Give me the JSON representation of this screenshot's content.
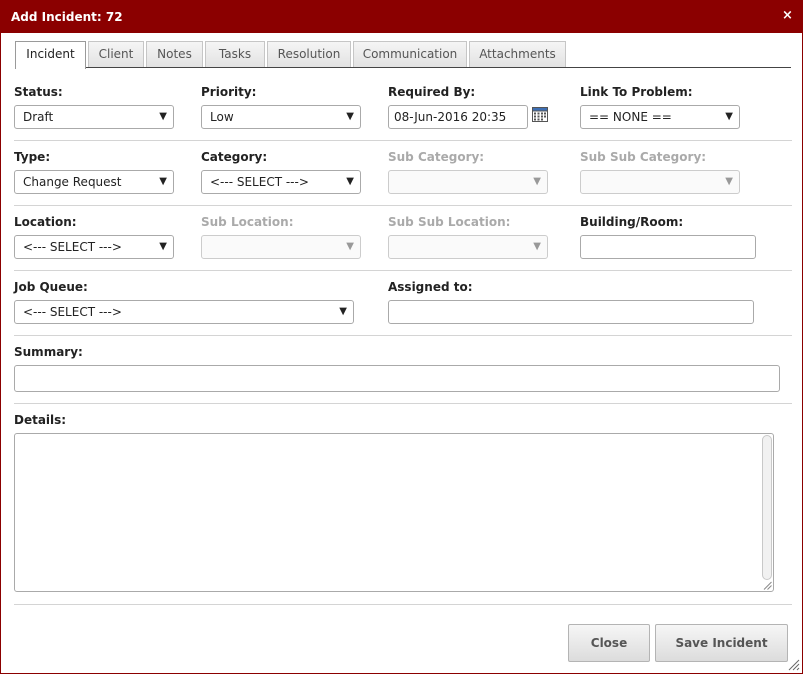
{
  "dialog": {
    "title": "Add Incident: 72",
    "close_glyph": "×",
    "colors": {
      "titlebar": "#8b0000"
    }
  },
  "tabs": [
    {
      "label": "Incident",
      "active": true
    },
    {
      "label": "Client"
    },
    {
      "label": "Notes"
    },
    {
      "label": "Tasks"
    },
    {
      "label": "Resolution"
    },
    {
      "label": "Communication"
    },
    {
      "label": "Attachments"
    }
  ],
  "form": {
    "status": {
      "label": "Status:",
      "value": "Draft"
    },
    "priority": {
      "label": "Priority:",
      "value": "Low"
    },
    "required_by": {
      "label": "Required By:",
      "value": "08-Jun-2016 20:35",
      "icon": "calendar-icon"
    },
    "link_to_problem": {
      "label": "Link To Problem:",
      "value": "== NONE =="
    },
    "type": {
      "label": "Type:",
      "value": "Change Request"
    },
    "category": {
      "label": "Category:",
      "value": "<--- SELECT --->"
    },
    "sub_category": {
      "label": "Sub Category:",
      "value": ""
    },
    "sub_sub_category": {
      "label": "Sub Sub Category:",
      "value": ""
    },
    "location": {
      "label": "Location:",
      "value": "<--- SELECT --->"
    },
    "sub_location": {
      "label": "Sub Location:",
      "value": ""
    },
    "sub_sub_location": {
      "label": "Sub Sub Location:",
      "value": ""
    },
    "building_room": {
      "label": "Building/Room:",
      "value": ""
    },
    "job_queue": {
      "label": "Job Queue:",
      "value": "<--- SELECT --->"
    },
    "assigned_to": {
      "label": "Assigned to:",
      "value": ""
    },
    "summary": {
      "label": "Summary:",
      "value": ""
    },
    "details": {
      "label": "Details:",
      "value": ""
    }
  },
  "buttons": {
    "close": "Close",
    "save": "Save Incident"
  }
}
